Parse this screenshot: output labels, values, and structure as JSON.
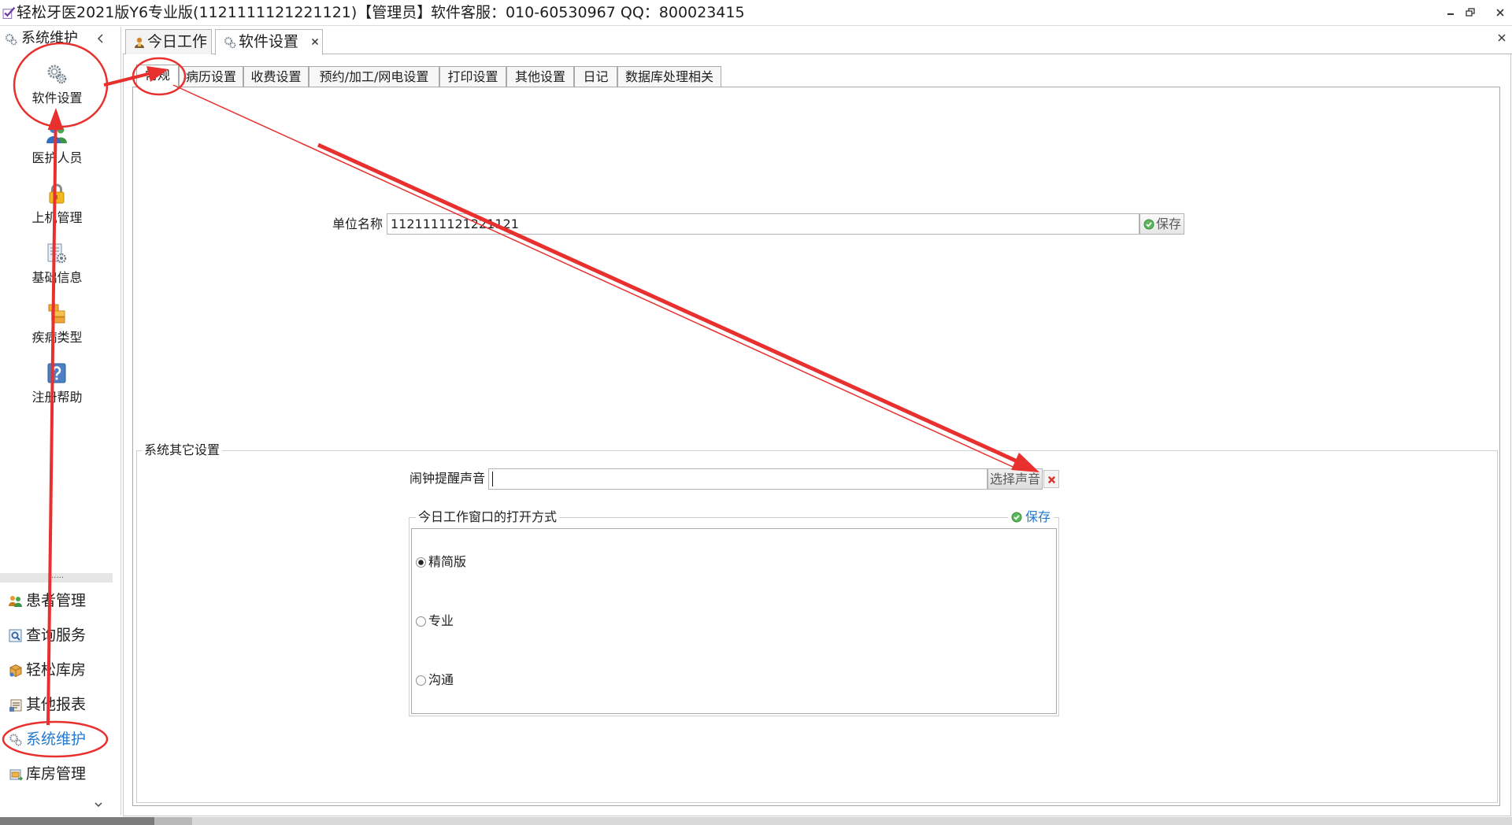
{
  "window": {
    "title": "轻松牙医2021版Y6专业版(1121111121221121)【管理员】",
    "support": "软件客服：010-60530967 QQ：800023415",
    "logo_icon": "app-logo-icon",
    "controls": [
      "minimize-icon",
      "restore-icon",
      "close-icon"
    ]
  },
  "sidebar": {
    "title": "系统维护",
    "header_icon": "gears-icon",
    "collapse_icon": "chevron-left-icon",
    "tools": [
      {
        "label": "软件设置",
        "icon": "gears-icon"
      },
      {
        "label": "医护人员",
        "icon": "users-icon"
      },
      {
        "label": "上机管理",
        "icon": "lock-icon"
      },
      {
        "label": "基础信息",
        "icon": "document-gear-icon"
      },
      {
        "label": "疾病类型",
        "icon": "folders-icon"
      },
      {
        "label": "注册帮助",
        "icon": "help-icon"
      }
    ],
    "splitter": "......",
    "nav": [
      {
        "label": "患者管理",
        "icon": "patients-icon",
        "active": false
      },
      {
        "label": "查询服务",
        "icon": "search-icon",
        "active": false
      },
      {
        "label": "轻松库房",
        "icon": "package-icon",
        "active": false
      },
      {
        "label": "其他报表",
        "icon": "report-icon",
        "active": false
      },
      {
        "label": "系统维护",
        "icon": "gears-icon",
        "active": true
      },
      {
        "label": "库房管理",
        "icon": "warehouse-icon",
        "active": false
      }
    ],
    "more_icon": "chevron-down-icon"
  },
  "tabs": [
    {
      "label": "今日工作",
      "icon": "worker-icon",
      "active": false
    },
    {
      "label": "软件设置",
      "icon": "gear-icon",
      "active": true,
      "close_icon": "close-tab-icon"
    }
  ],
  "close_all_icon": "close-all-icon",
  "subtabs": [
    {
      "label": "常规",
      "active": true
    },
    {
      "label": "病历设置",
      "active": false
    },
    {
      "label": "收费设置",
      "active": false
    },
    {
      "label": "预约/加工/网电设置",
      "active": false
    },
    {
      "label": "打印设置",
      "active": false
    },
    {
      "label": "其他设置",
      "active": false
    },
    {
      "label": "日记",
      "active": false
    },
    {
      "label": "数据库处理相关",
      "active": false
    }
  ],
  "general": {
    "unit_name_label": "单位名称",
    "unit_name_value": "1121111121221121",
    "save_label": "保存",
    "save_icon": "check-circle-icon"
  },
  "other_settings": {
    "legend": "系统其它设置",
    "alarm_label": "闹钟提醒声音",
    "alarm_value": "",
    "choose_sound_label": "选择声音",
    "clear_icon": "clear-icon",
    "window_mode": {
      "legend": "今日工作窗口的打开方式",
      "save_label": "保存",
      "save_icon": "check-circle-icon",
      "options": [
        {
          "label": "精简版",
          "checked": true
        },
        {
          "label": "专业",
          "checked": false
        },
        {
          "label": "沟通",
          "checked": false
        }
      ]
    }
  },
  "colors": {
    "accent": "#2378cf",
    "annotation": "#e8302e",
    "save_icon": "#5cb85c",
    "clear_icon": "#d9342b"
  }
}
